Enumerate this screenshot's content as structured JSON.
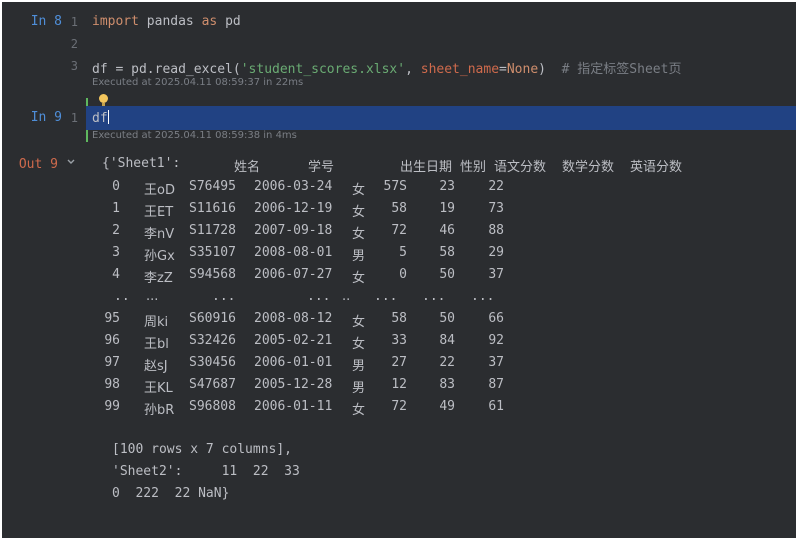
{
  "cells": [
    {
      "prompt": "In 8",
      "line_numbers": [
        "1",
        "2",
        "3"
      ],
      "lines": [
        {
          "parts": [
            [
              "kw",
              "import"
            ],
            [
              "plain",
              " pandas "
            ],
            [
              "kw",
              "as"
            ],
            [
              "plain",
              " pd"
            ]
          ]
        },
        {
          "parts": []
        },
        {
          "parts": [
            [
              "plain",
              "df = pd.read_excel("
            ],
            [
              "str",
              "'student_scores.xlsx'"
            ],
            [
              "plain",
              ", "
            ],
            [
              "param",
              "sheet_name"
            ],
            [
              "plain",
              "="
            ],
            [
              "const",
              "None"
            ],
            [
              "plain",
              ")  "
            ],
            [
              "comment",
              "# 指定标签Sheet页"
            ]
          ]
        }
      ],
      "executed": "Executed at 2025.04.11 08:59:37 in 22ms"
    },
    {
      "prompt": "In 9",
      "line_numbers": [
        "1"
      ],
      "code": "df",
      "executed": "Executed at 2025.04.11 08:59:38 in 4ms"
    }
  ],
  "output": {
    "prompt": "Out 9",
    "dict_open": "{'Sheet1':",
    "headers": [
      "姓名",
      "学号",
      "出生日期",
      "性别",
      "语文分数",
      "数学分数",
      "英语分数"
    ],
    "rows": [
      [
        "0",
        "王oD",
        "S76495",
        "2006-03-24",
        "女",
        "57S",
        "23",
        "22"
      ],
      [
        "1",
        "王ET",
        "S11616",
        "2006-12-19",
        "女",
        "58",
        "19",
        "73"
      ],
      [
        "2",
        "李nV",
        "S11728",
        "2007-09-18",
        "女",
        "72",
        "46",
        "88"
      ],
      [
        "3",
        "孙Gx",
        "S35107",
        "2008-08-01",
        "男",
        "5",
        "58",
        "29"
      ],
      [
        "4",
        "李zZ",
        "S94568",
        "2006-07-27",
        "女",
        "0",
        "50",
        "37"
      ],
      [
        "..",
        "...",
        "...",
        "...",
        "..",
        "...",
        "...",
        "..."
      ],
      [
        "95",
        "周ki",
        "S60916",
        "2008-08-12",
        "女",
        "58",
        "50",
        "66"
      ],
      [
        "96",
        "王bl",
        "S32426",
        "2005-02-21",
        "女",
        "33",
        "84",
        "92"
      ],
      [
        "97",
        "赵sJ",
        "S30456",
        "2006-01-01",
        "男",
        "27",
        "22",
        "37"
      ],
      [
        "98",
        "王KL",
        "S47687",
        "2005-12-28",
        "男",
        "12",
        "83",
        "87"
      ],
      [
        "99",
        "孙bR",
        "S96808",
        "2006-01-11",
        "女",
        "72",
        "49",
        "61"
      ]
    ],
    "summary": "[100 rows x 7 columns],",
    "sheet2_line": "'Sheet2':     11  22  33",
    "sheet2_row": "0  222  22 NaN}"
  },
  "colors": {
    "background": "#2b2d30",
    "selection": "#214283",
    "keyword": "#cf8e6d",
    "string": "#6aab73",
    "in_prompt": "#4f8ed8",
    "out_prompt": "#cf6a4c"
  }
}
